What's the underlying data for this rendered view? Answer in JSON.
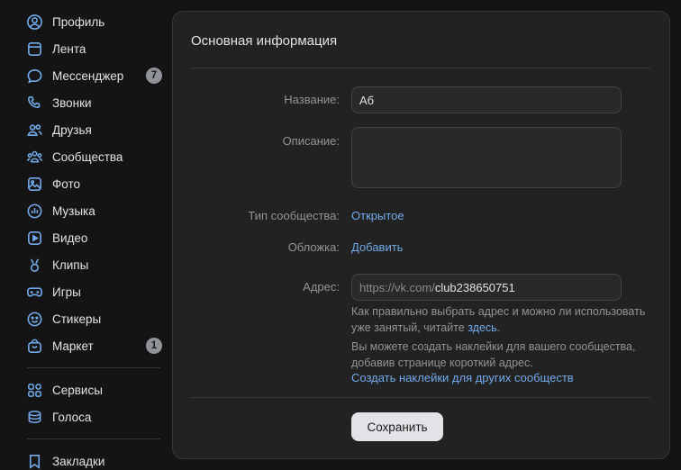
{
  "sidebar": {
    "items": [
      {
        "label": "Профиль",
        "icon": "user-circle-icon"
      },
      {
        "label": "Лента",
        "icon": "newsfeed-icon"
      },
      {
        "label": "Мессенджер",
        "icon": "message-bubble-icon",
        "badge": "7"
      },
      {
        "label": "Звонки",
        "icon": "phone-icon"
      },
      {
        "label": "Друзья",
        "icon": "friends-icon"
      },
      {
        "label": "Сообщества",
        "icon": "communities-icon"
      },
      {
        "label": "Фото",
        "icon": "photo-icon"
      },
      {
        "label": "Музыка",
        "icon": "music-icon"
      },
      {
        "label": "Видео",
        "icon": "video-icon"
      },
      {
        "label": "Клипы",
        "icon": "clips-icon"
      },
      {
        "label": "Игры",
        "icon": "gamepad-icon"
      },
      {
        "label": "Стикеры",
        "icon": "smile-icon"
      },
      {
        "label": "Маркет",
        "icon": "bag-icon",
        "badge": "1"
      },
      {
        "label": "Сервисы",
        "icon": "services-grid-icon"
      },
      {
        "label": "Голоса",
        "icon": "coins-icon"
      },
      {
        "label": "Закладки",
        "icon": "bookmark-icon"
      }
    ]
  },
  "panel": {
    "title": "Основная информация",
    "name_label": "Название:",
    "name_value": "Аб",
    "description_label": "Описание:",
    "description_value": "",
    "type_label": "Тип сообщества:",
    "type_value": "Открытое",
    "cover_label": "Обложка:",
    "cover_link": "Добавить",
    "address_label": "Адрес:",
    "address_prefix": "https://vk.com/",
    "address_value": "club238650751",
    "hint1_text": "Как правильно выбрать адрес и можно ли использовать уже занятый, читайте ",
    "hint1_link": "здесь",
    "hint1_end": ".",
    "hint2_text": "Вы можете создать наклейки для вашего сообщества, добавив странице короткий адрес.",
    "hint2_link": "Создать наклейки для других сообществ",
    "save_label": "Сохранить"
  },
  "colors": {
    "background": "#141414",
    "panel": "#222222",
    "accent_link": "#71aaeb",
    "icon": "#71aaeb",
    "badge": "#909499"
  }
}
